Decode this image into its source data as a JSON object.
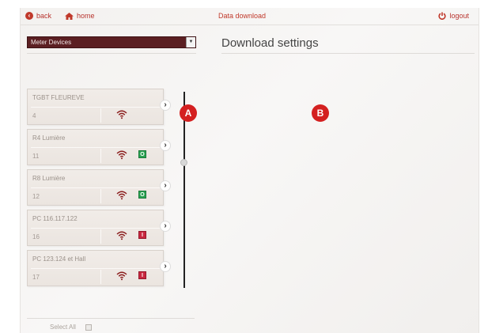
{
  "topbar": {
    "back_label": "back",
    "home_label": "home",
    "title": "Data download",
    "logout_label": "logout"
  },
  "selector": {
    "value": "Meter Devices"
  },
  "settings": {
    "title": "Download settings"
  },
  "devices": [
    {
      "name": "TGBT FLEUREVE",
      "id": "4",
      "status": ""
    },
    {
      "name": "R4 Lumière",
      "id": "11",
      "status": "O"
    },
    {
      "name": "R8 Lumière",
      "id": "12",
      "status": "O"
    },
    {
      "name": "PC 116.117.122",
      "id": "16",
      "status": "I"
    },
    {
      "name": "PC 123.124 et Hall",
      "id": "17",
      "status": "I"
    }
  ],
  "markers": {
    "a": "A",
    "b": "B"
  },
  "select_all": {
    "label": "Select All"
  },
  "colors": {
    "accent": "#c0392b",
    "on": "#2aa152",
    "off": "#c8273f",
    "selector_bg": "#5b1f22"
  }
}
